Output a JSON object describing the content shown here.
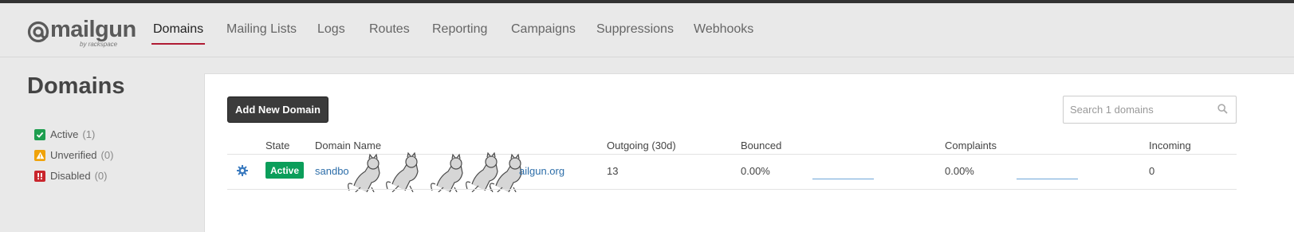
{
  "brand": {
    "name": "mailgun",
    "sub": "by rackspace"
  },
  "nav": {
    "items": [
      {
        "label": "Domains",
        "active": true
      },
      {
        "label": "Mailing Lists"
      },
      {
        "label": "Logs"
      },
      {
        "label": "Routes"
      },
      {
        "label": "Reporting"
      },
      {
        "label": "Campaigns"
      },
      {
        "label": "Suppressions"
      },
      {
        "label": "Webhooks"
      }
    ]
  },
  "sidebar": {
    "title": "Domains",
    "filters": [
      {
        "label": "Active",
        "count": "(1)",
        "color": "#1e9e4f",
        "icon": "check-icon"
      },
      {
        "label": "Unverified",
        "count": "(0)",
        "color": "#f0a30a",
        "icon": "warning-icon"
      },
      {
        "label": "Disabled",
        "count": "(0)",
        "color": "#c9252c",
        "icon": "alert-icon"
      }
    ]
  },
  "main": {
    "add_button": "Add New Domain",
    "search_placeholder": "Search 1 domains",
    "columns": [
      "State",
      "Domain Name",
      "Outgoing (30d)",
      "Bounced",
      "Complaints",
      "Incoming"
    ],
    "rows": [
      {
        "state": "Active",
        "domain_start": "sandbo",
        "domain_end": "ailgun.org",
        "outgoing": "13",
        "bounced": "0.00%",
        "complaints": "0.00%",
        "incoming": "0"
      }
    ]
  },
  "colors": {
    "accent": "#b01c34",
    "active_badge": "#0b9e5a",
    "link": "#2d6ea9"
  }
}
